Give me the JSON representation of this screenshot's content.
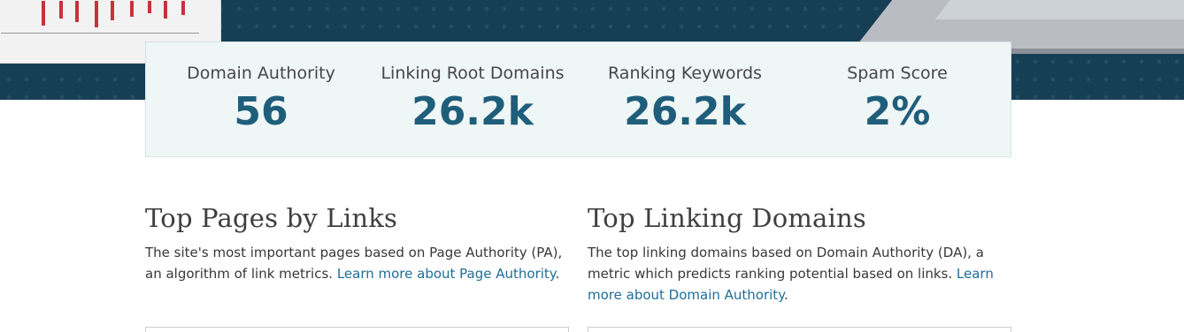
{
  "metrics": [
    {
      "label": "Domain Authority",
      "value": "56"
    },
    {
      "label": "Linking Root Domains",
      "value": "26.2k"
    },
    {
      "label": "Ranking Keywords",
      "value": "26.2k"
    },
    {
      "label": "Spam Score",
      "value": "2%"
    }
  ],
  "top_pages": {
    "title": "Top Pages by Links",
    "desc_text": "The site's most important pages based on Page Authority (PA), an algorithm of link metrics. ",
    "link_text": "Learn more about Page Authority",
    "desc_tail": "."
  },
  "top_domains": {
    "title": "Top Linking Domains",
    "desc_text": "The top linking domains based on Domain Authority (DA), a metric which predicts ranking potential based on links. ",
    "link_text": "Learn more about Domain Authority",
    "desc_tail": "."
  },
  "colors": {
    "hero_background": "#163f55",
    "metric_value": "#1f5e7b",
    "link": "#1f6d98",
    "chart_bar": "#c8323c"
  }
}
